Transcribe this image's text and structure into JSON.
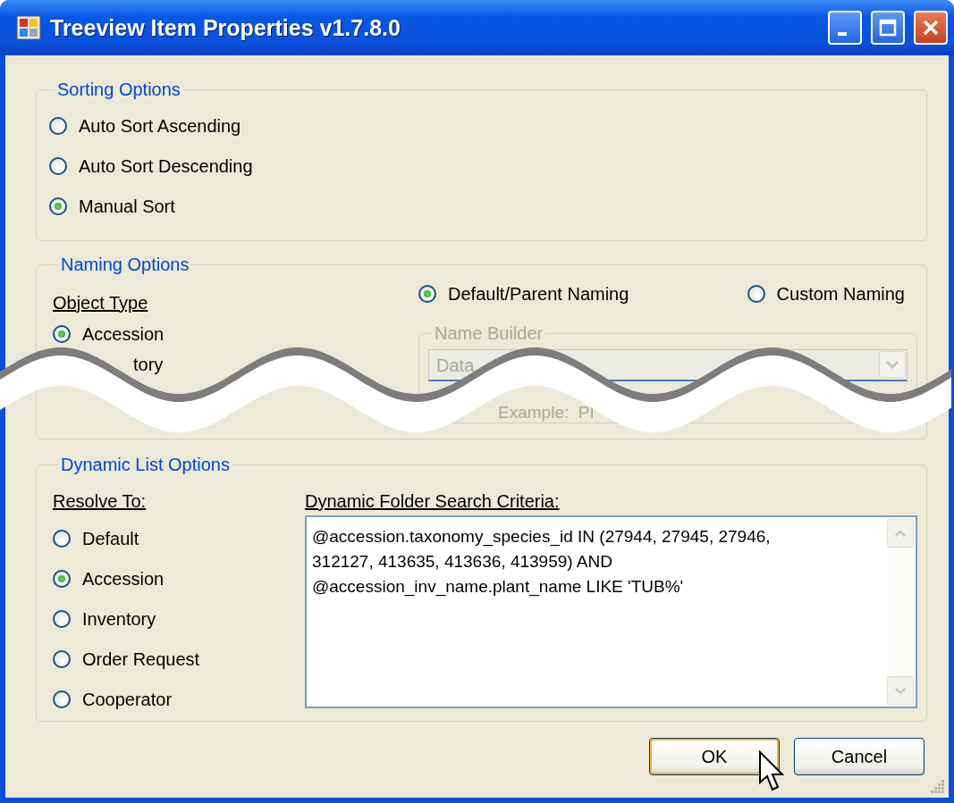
{
  "window": {
    "title": "Treeview Item Properties v1.7.8.0"
  },
  "sorting": {
    "legend": "Sorting Options",
    "options": [
      {
        "label": "Auto Sort Ascending",
        "selected": false
      },
      {
        "label": "Auto Sort Descending",
        "selected": false
      },
      {
        "label": "Manual Sort",
        "selected": true
      }
    ]
  },
  "naming": {
    "legend": "Naming Options",
    "object_type": {
      "label": "Object Type",
      "options": [
        {
          "label": "Accession",
          "selected": true
        }
      ],
      "partial_label": "tory"
    },
    "modes": [
      {
        "label": "Default/Parent Naming",
        "selected": true
      },
      {
        "label": "Custom Naming",
        "selected": false
      }
    ],
    "name_builder": {
      "legend": "Name Builder",
      "disabled": true,
      "field_value": "Data",
      "example": "Example:  PI"
    }
  },
  "dynamic": {
    "legend": "Dynamic List Options",
    "resolve_to": {
      "label": "Resolve To:",
      "options": [
        {
          "label": "Default",
          "selected": false
        },
        {
          "label": "Accession",
          "selected": true
        },
        {
          "label": "Inventory",
          "selected": false
        },
        {
          "label": "Order Request",
          "selected": false
        },
        {
          "label": "Cooperator",
          "selected": false
        }
      ]
    },
    "criteria": {
      "label": "Dynamic Folder Search Criteria:",
      "value": "@accession.taxonomy_species_id IN (27944, 27945, 27946,\n312127, 413635, 413636, 413959) AND\n@accession_inv_name.plant_name LIKE 'TUB%'"
    }
  },
  "buttons": [
    {
      "label": "OK",
      "default": true
    },
    {
      "label": "Cancel",
      "default": false
    }
  ]
}
